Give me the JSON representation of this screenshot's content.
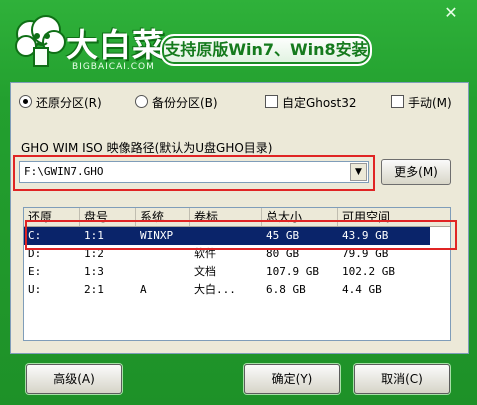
{
  "window": {
    "close_glyph": "✕"
  },
  "header": {
    "brand_cn": "大白菜",
    "brand_en": "BIGBAICAI.COM",
    "slogan": "支持原版Win7、Win8安装"
  },
  "options": {
    "restore": "还原分区(R)",
    "backup": "备份分区(B)",
    "custom_ghost": "自定Ghost32",
    "manual": "手动(M)",
    "selected": "restore"
  },
  "path": {
    "label": "GHO WIM ISO 映像路径(默认为U盘GHO目录)",
    "value": "F:\\GWIN7.GHO",
    "more_label": "更多(M)"
  },
  "table": {
    "columns": [
      "还原",
      "盘号",
      "系统",
      "卷标",
      "总大小",
      "可用空间"
    ],
    "rows": [
      [
        "C:",
        "1:1",
        "WINXP",
        "",
        "45 GB",
        "43.9 GB"
      ],
      [
        "D:",
        "1:2",
        "",
        "软件",
        "80 GB",
        "79.9 GB"
      ],
      [
        "E:",
        "1:3",
        "",
        "文档",
        "107.9 GB",
        "102.2 GB"
      ],
      [
        "U:",
        "2:1",
        "A",
        "大白...",
        "6.8 GB",
        "4.4 GB"
      ]
    ],
    "selected_row": 0
  },
  "footer": {
    "advanced": "高级(A)",
    "ok": "确定(Y)",
    "cancel": "取消(C)"
  },
  "colors": {
    "frame": "#23a02f",
    "highlight": "#e02424",
    "selection": "#0a246a"
  },
  "icons": {
    "logo": "cabbage-logo-icon",
    "close": "close-icon",
    "dropdown": "chevron-down-icon"
  }
}
